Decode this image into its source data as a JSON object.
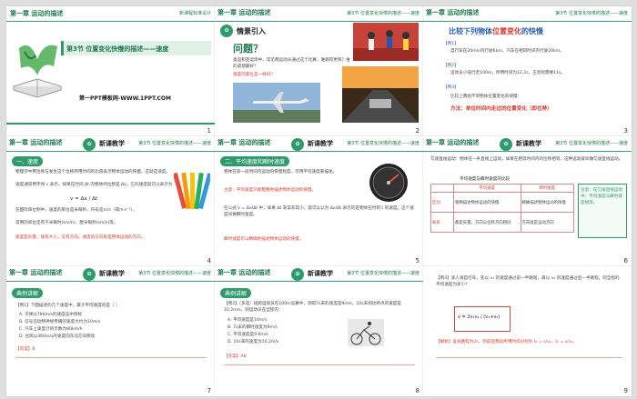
{
  "common": {
    "chapter": "第一章  运动的描述",
    "section_short": "第3节  位置变化快慢的描述——速度",
    "label_new": "新课教学",
    "series_label": "新课程标准设计"
  },
  "slides": [
    {
      "num": "1",
      "title": "第3节  位置变化快慢的描述——速度",
      "brand": "第一PPT模板网-WWW.1PPT.COM"
    },
    {
      "num": "2",
      "heading": "情景引入",
      "question": "问题？",
      "text": "奥运和亚运场中，常见两运动员通过这个比赛，谁跑得更快？谁的成绩最好？",
      "red": "速度的变化是一样吗？"
    },
    {
      "num": "3",
      "title_a": "比较下列物体",
      "title_b": "位置变化",
      "title_c": "的快慢",
      "l1": "【例1】",
      "t1": "自行车在20min内行驶6km，汽车在相同时间内行驶20km。",
      "l2": "【例2】",
      "t2": "运动员小强行走100m，所用时间为12.2s，王亮则需要11s。",
      "l3": "【例3】",
      "t3": "比较上两组不同物体位置变化的快慢：",
      "method": "方法：单位时间内走过的位置变化（即位移）"
    },
    {
      "num": "4",
      "pill": "一、速度",
      "t1": "物理学中用位移与发生这个位移所用时间的比值表示物体运动的快慢，这就是速度。",
      "t2": "速度通常用字母 v 表示。如果在时间 Δt 内物体的位移是 Δx，它的速度就可以表示为",
      "formula": "v = Δx / Δt",
      "t3": "在国际单位制中，速度的单位是米每秒，符号是m/s（或m·s⁻¹）。",
      "t4": "常用的单位还有千米每时(km/h)、厘米每秒(cm/s)等。",
      "red": "速度是矢量，既有大小，又有方向。速度的方向就是物体运动的方向。"
    },
    {
      "num": "5",
      "pill": "二、平均速度和瞬时速度",
      "t1": "物体在某一段时间内运动的快慢程度，可用平均速度来描述。",
      "red1": "注意：平均速度只能粗略地描述物体运动的快慢。",
      "t2": "在公式 v = Δx/Δt 中，如果 Δt 非常非常小，就可以认为 Δx/Δt 表示的是物体在时刻 t 的速度，这个速度叫做瞬时速度。",
      "red2": "瞬时速度可以精确地描述物体运动的快慢。"
    },
    {
      "num": "6",
      "top": "匀速直线运动：物体在一条直线上运动，如果在相等时间内的位移相等，这种运动就叫做匀速直线运动。",
      "table_title": "平均速度与瞬时速度的比较",
      "h1": "平均速度",
      "h2": "瞬时速度",
      "r1": "区别",
      "r1a": "粗略描述物体运动的快慢",
      "r1b": "精确描述物体运动的快慢",
      "r2": "联系",
      "r2a": "都是矢量，方向与位移方向相同",
      "r2b": "方向就是运动方向",
      "note": "注意：在匀速直线运动中，平均速度与瞬时速度相等。"
    },
    {
      "num": "7",
      "pill": "典例讲解",
      "t1": "【例1】下面描述的几个速度中，属于平均速度的是（ ）",
      "opts": [
        "A. 子弹以790m/s的速度击中目标",
        "B. 信号沿动物神经传播的速度大约为10m/s",
        "C. 汽车上速度计的示数为80km/h",
        "D. 台风以360m/s的速度向东北方向移动"
      ],
      "ans": "【答案】B"
    },
    {
      "num": "8",
      "pill": "典例讲解",
      "t1": "【例2】（多选）短跑运动员在100m竞赛中，测得7s末的速度是9m/s，10s末到达终点的速度是10.2m/s，则运动员在全程内：",
      "opts": [
        "A. 平均速度是10m/s",
        "B. 7s末的瞬时速度为9m/s",
        "C. 平均速度是9.6m/s",
        "D. 10s末的速度为10.2m/s"
      ],
      "ans": "【答案】AB"
    },
    {
      "num": "9",
      "t1": "【例3】某人骑自行车，先以 v₁ 的速度通过前一半路程，再以 v₂ 的速度通过后一半路程，则全程的平均速度为多少？",
      "formula": "v = 2v₁v₂ / (v₁+v₂)",
      "ans": "【解析】设总路程为2s，则前后两段所用时间分别为 t₁ = s/v₁，t₂ = s/v₂。"
    }
  ]
}
